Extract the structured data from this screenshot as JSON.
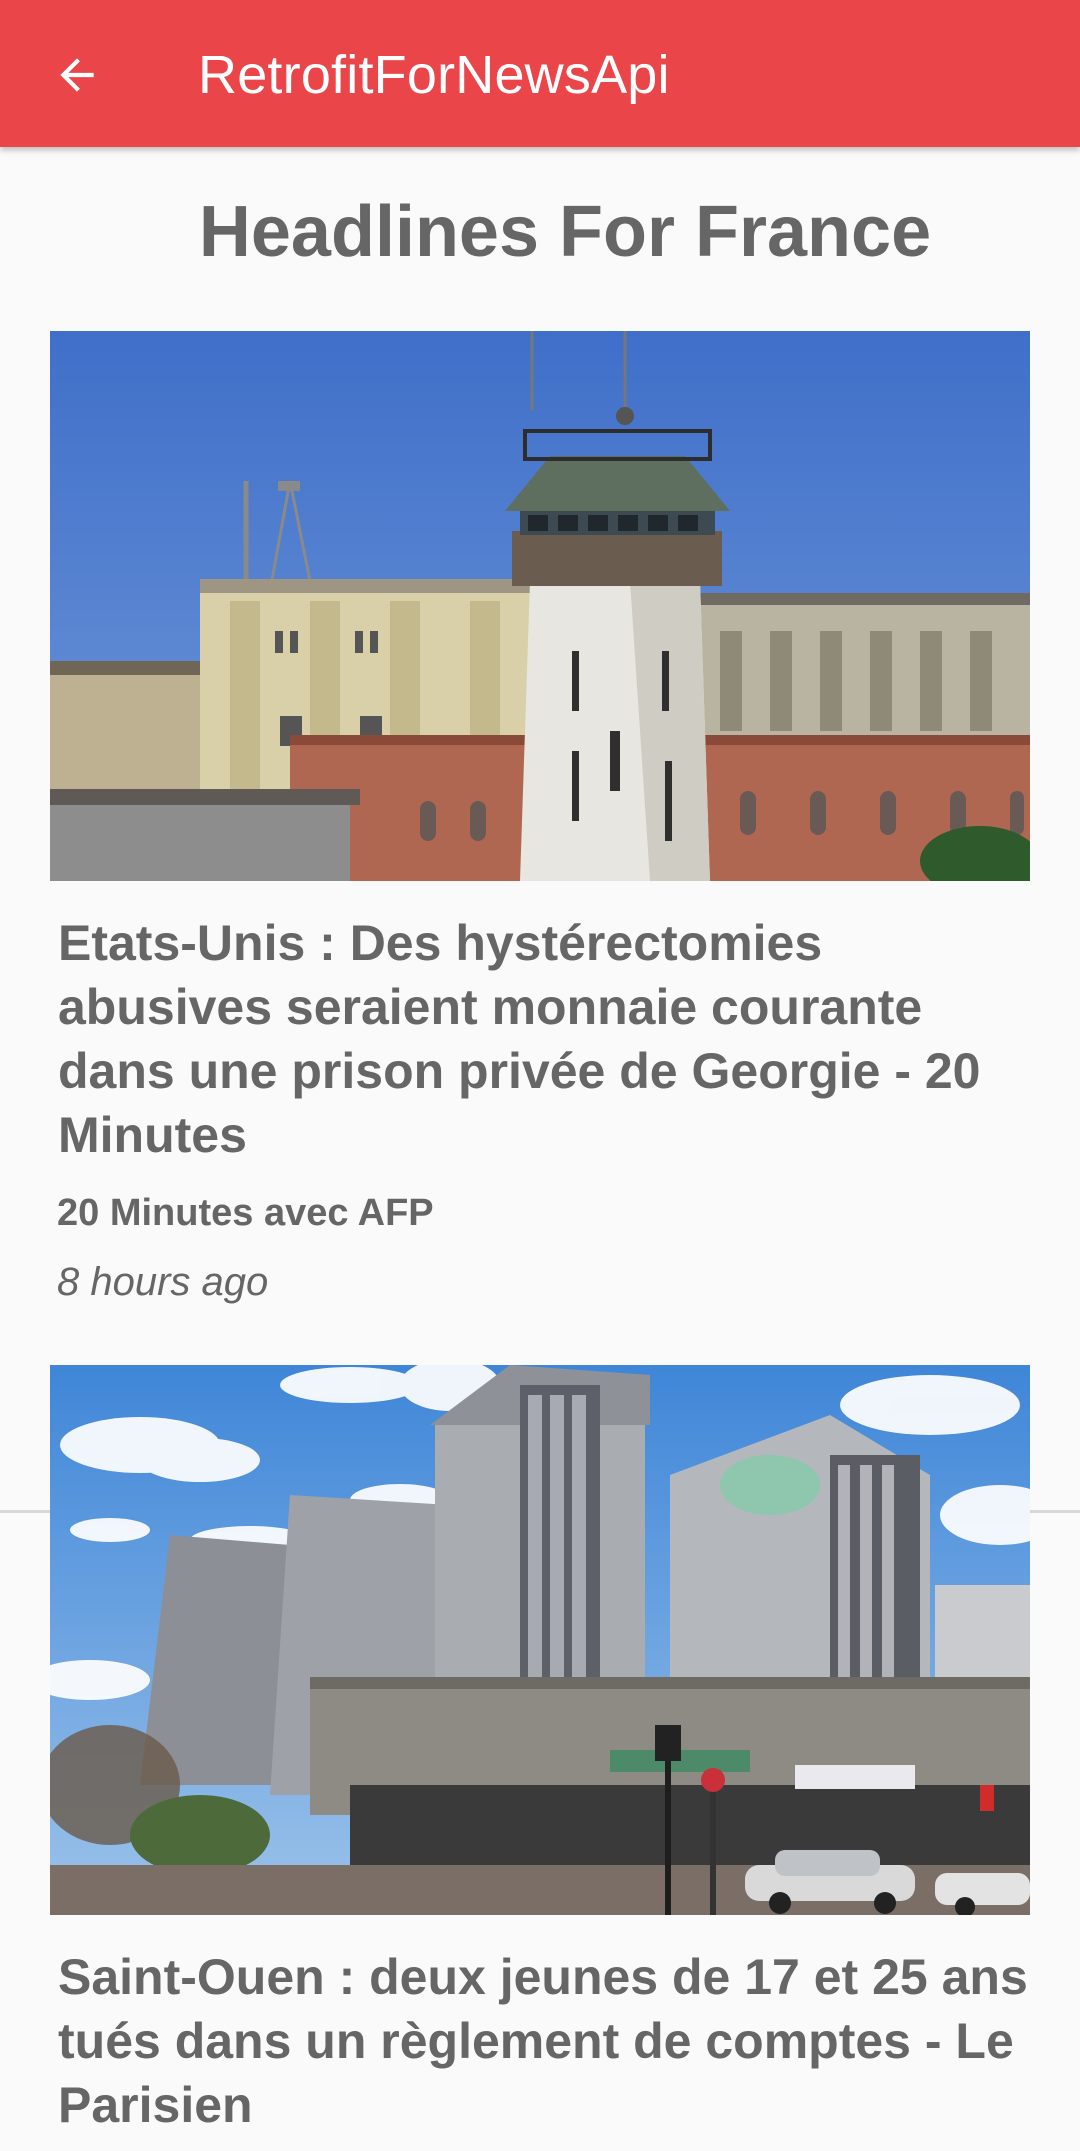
{
  "app_bar": {
    "title": "RetrofitForNewsApi",
    "back_icon": "arrow-left-icon",
    "color": "#ea464a"
  },
  "main": {
    "heading": "Headlines For France",
    "articles": [
      {
        "title": "Etats-Unis : Des hystérectomies abusives seraient monnaie courante dans une prison privée de Georgie - 20 Minutes",
        "source": "20 Minutes avec AFP",
        "time": "8 hours ago",
        "image": "prison-watchtower-photo"
      },
      {
        "title": "Saint-Ouen : deux jeunes de 17 et 25 ans tués dans un règlement de comptes - Le Parisien",
        "image": "apartment-towers-photo"
      }
    ]
  }
}
